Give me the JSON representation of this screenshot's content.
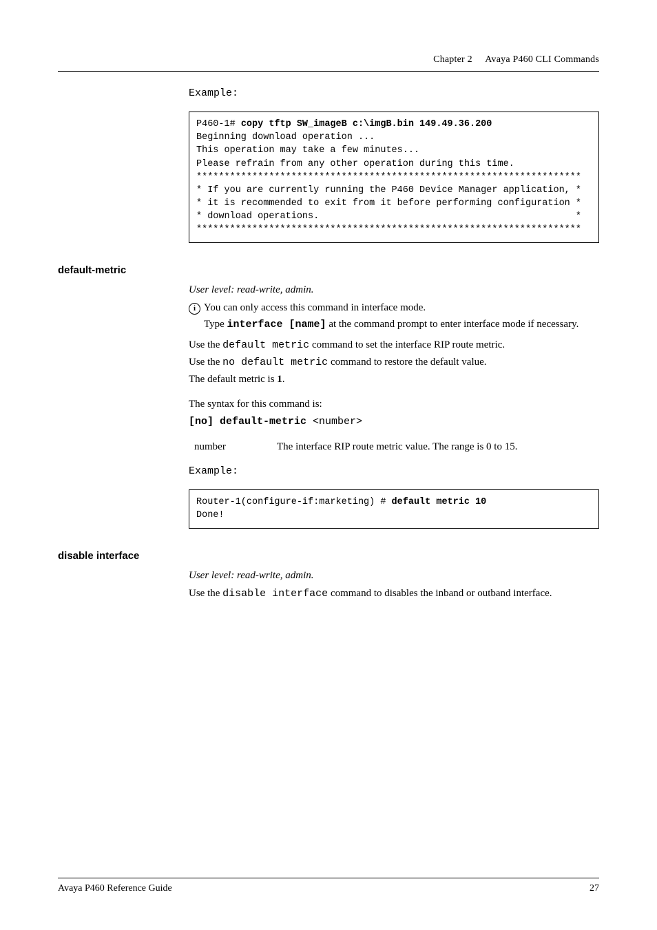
{
  "header": {
    "chapter": "Chapter 2",
    "title": "Avaya P460 CLI Commands"
  },
  "example1": {
    "label": "Example:",
    "prompt": "P460-1# ",
    "command": "copy tftp SW_imageB c:\\imgB.bin 149.49.36.200",
    "l1": "Beginning download operation ...",
    "l2": "This operation may take a few minutes...",
    "l3": "Please refrain from any other operation during this time.",
    "stars": "*********************************************************************",
    "l4": "* If you are currently running the P460 Device Manager application, *",
    "l5": "* it is recommended to exit from it before performing configuration *",
    "l6": "* download operations.                                              *"
  },
  "section1": {
    "heading": "default-metric",
    "userlevel": "User level: read-write, admin.",
    "note1_a": "You can only access this command in interface mode.",
    "note1_b_pre": "Type ",
    "note1_b_cmd": "interface  [name]",
    "note1_b_post": " at the command prompt to enter interface mode if necessary.",
    "p1_a": "Use the ",
    "p1_code": "default metric",
    "p1_b": " command to set the interface RIP route metric.",
    "p2_a": "Use the ",
    "p2_code": "no default metric",
    "p2_b": " command to restore the default value.",
    "p3": "The default metric is ",
    "p3_bold": "1",
    "p3_end": ".",
    "syntax_intro": "The syntax for this command is:",
    "syntax_cmd": "[no] default-metric",
    "syntax_arg": " <number>",
    "param_name": "number",
    "param_desc": "The interface RIP route metric value. The range is 0 to 15.",
    "example_label": "Example:",
    "ex_prompt": "Router-1(configure-if:marketing) # ",
    "ex_cmd": "default metric 10",
    "ex_out": "Done!"
  },
  "section2": {
    "heading": "disable interface",
    "userlevel": "User level: read-write, admin.",
    "p1_a": "Use the ",
    "p1_code": "disable interface",
    "p1_b": " command to disables the inband or outband interface."
  },
  "footer": {
    "doc": "Avaya P460 Reference Guide",
    "page": "27"
  }
}
